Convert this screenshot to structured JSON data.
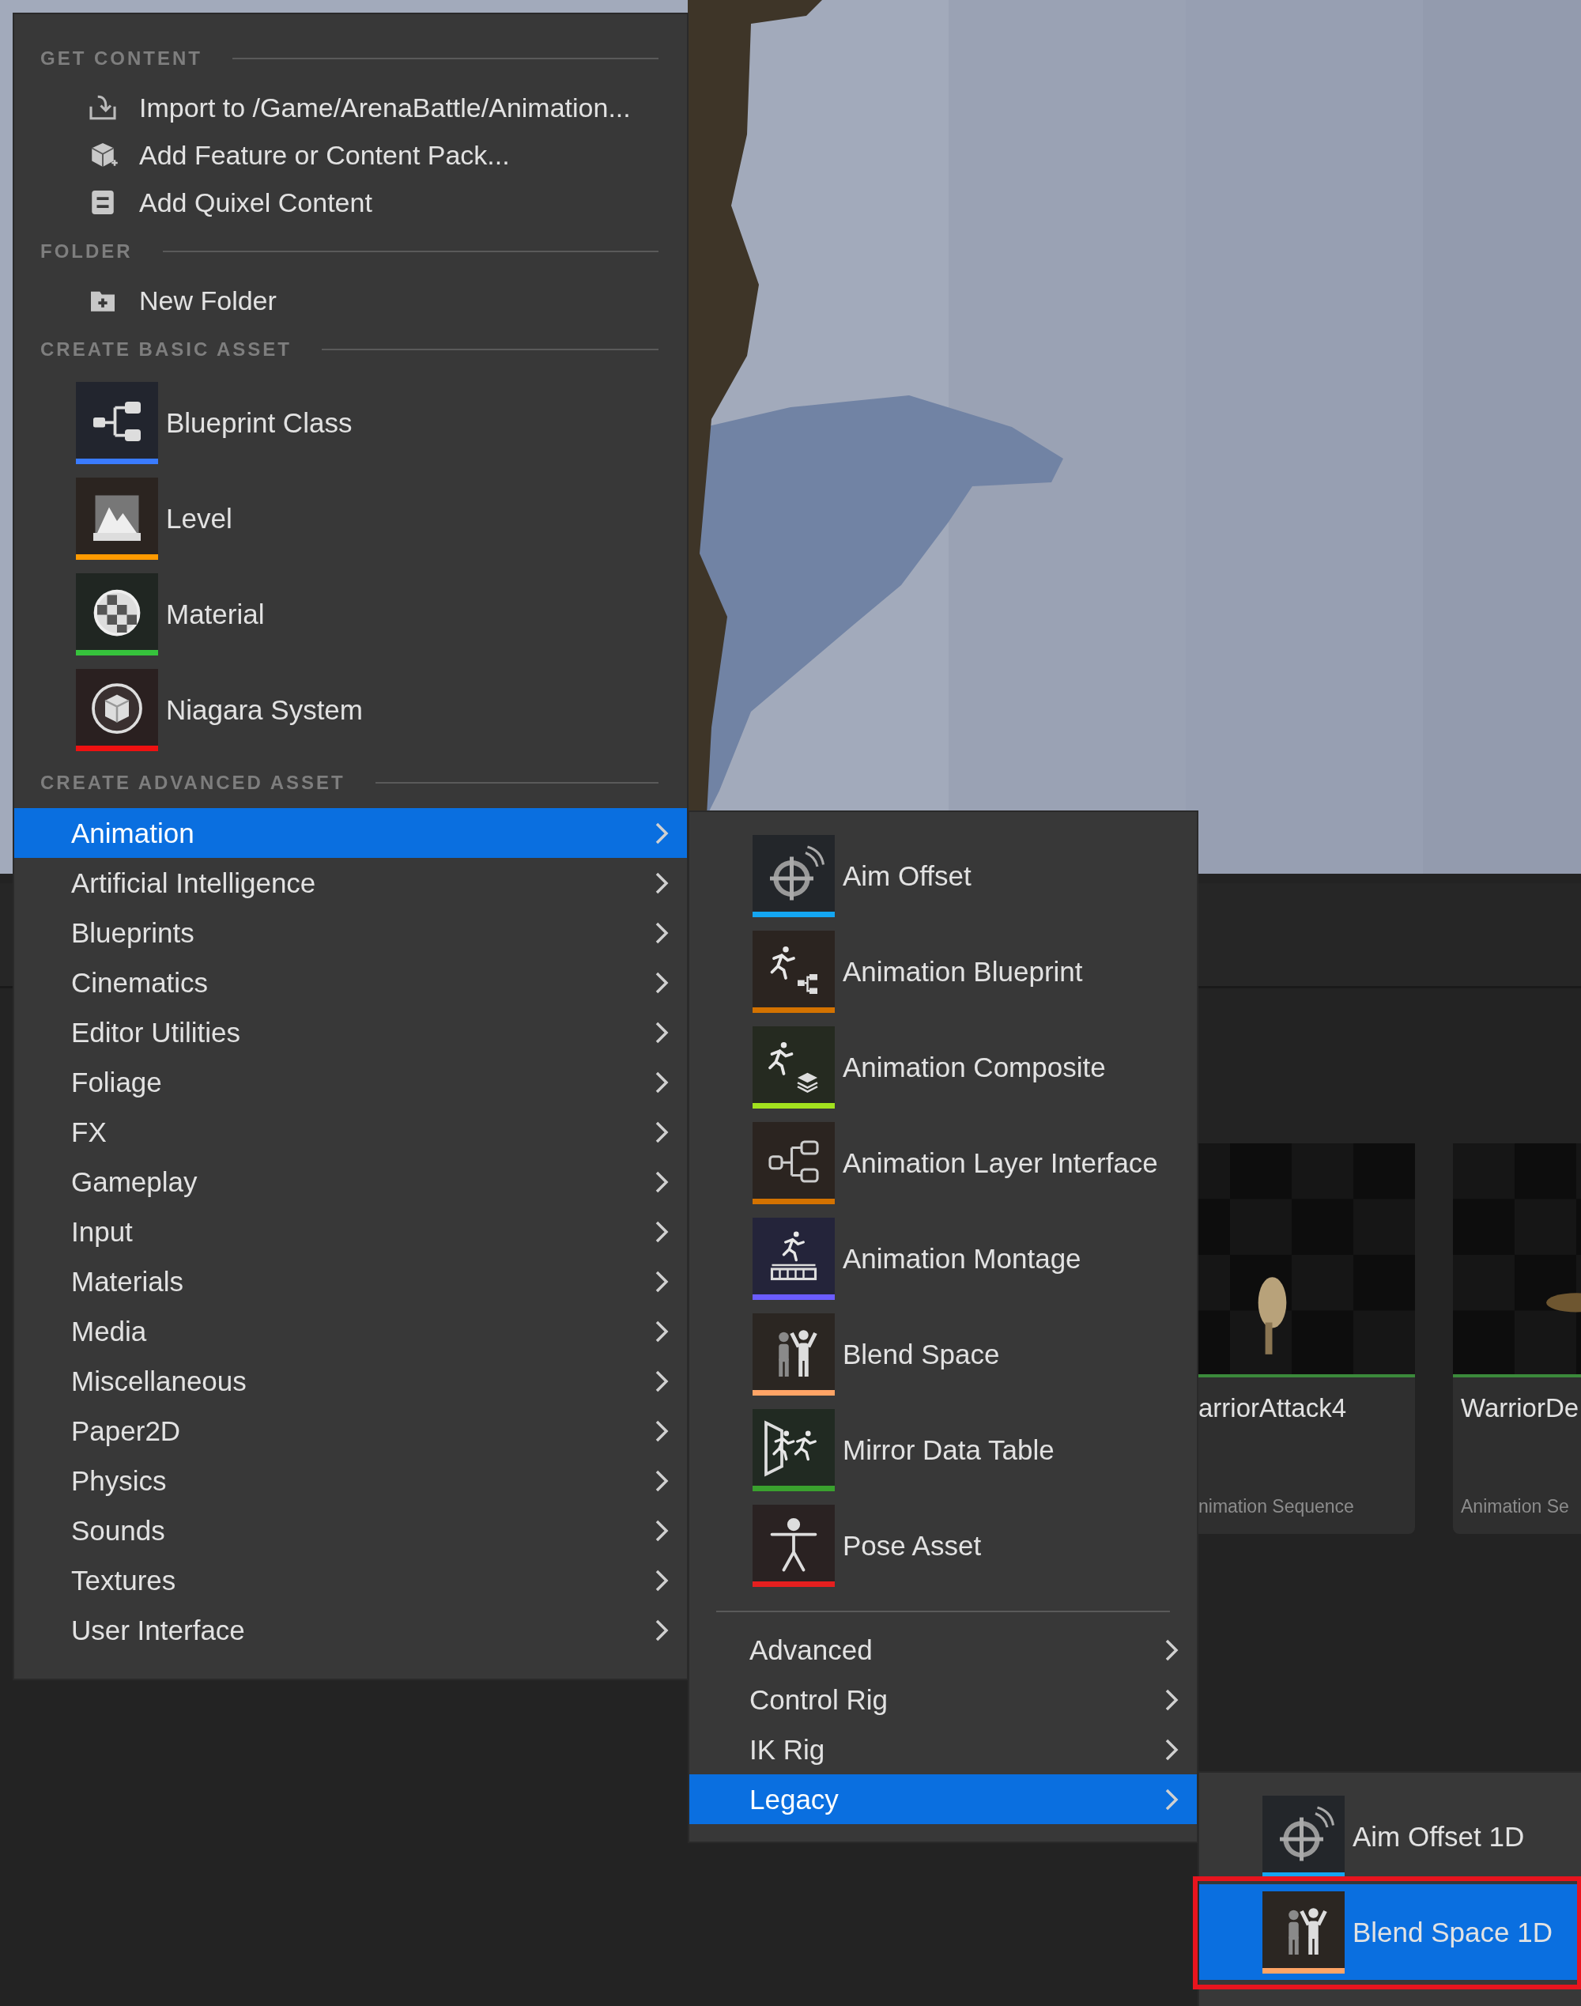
{
  "menu": {
    "sections": [
      {
        "header": "GET CONTENT",
        "items": [
          {
            "kind": "import",
            "label": "Import to /Game/ArenaBattle/Animation..."
          },
          {
            "kind": "pack",
            "label": "Add Feature or Content Pack..."
          },
          {
            "kind": "quixel",
            "label": "Add Quixel Content"
          }
        ]
      },
      {
        "header": "FOLDER",
        "items": [
          {
            "kind": "folder",
            "label": "New Folder"
          }
        ]
      },
      {
        "header": "CREATE BASIC ASSET",
        "assets": [
          {
            "kind": "blueprint",
            "label": "Blueprint Class",
            "color": "#3a7bff"
          },
          {
            "kind": "landscape",
            "label": "Level",
            "color": "#ff9a00"
          },
          {
            "kind": "sphere",
            "label": "Material",
            "color": "#36c23c"
          },
          {
            "kind": "cube",
            "label": "Niagara System",
            "color": "#ee1111"
          }
        ]
      },
      {
        "header": "CREATE ADVANCED ASSET",
        "categories": [
          {
            "label": "Animation",
            "selected": true
          },
          {
            "label": "Artificial Intelligence",
            "selected": false
          },
          {
            "label": "Blueprints",
            "selected": false
          },
          {
            "label": "Cinematics",
            "selected": false
          },
          {
            "label": "Editor Utilities",
            "selected": false
          },
          {
            "label": "Foliage",
            "selected": false
          },
          {
            "label": "FX",
            "selected": false
          },
          {
            "label": "Gameplay",
            "selected": false
          },
          {
            "label": "Input",
            "selected": false
          },
          {
            "label": "Materials",
            "selected": false
          },
          {
            "label": "Media",
            "selected": false
          },
          {
            "label": "Miscellaneous",
            "selected": false
          },
          {
            "label": "Paper2D",
            "selected": false
          },
          {
            "label": "Physics",
            "selected": false
          },
          {
            "label": "Sounds",
            "selected": false
          },
          {
            "label": "Textures",
            "selected": false
          },
          {
            "label": "User Interface",
            "selected": false
          }
        ]
      }
    ]
  },
  "animation_submenu": {
    "assets": [
      {
        "kind": "crosshair",
        "label": "Aim Offset",
        "color": "#14a6f2"
      },
      {
        "kind": "runner-graph",
        "label": "Animation Blueprint",
        "color": "#d37200"
      },
      {
        "kind": "runner-layers",
        "label": "Animation Composite",
        "color": "#a2e21e"
      },
      {
        "kind": "graph",
        "label": "Animation Layer Interface",
        "color": "#d37200"
      },
      {
        "kind": "runner-track",
        "label": "Animation Montage",
        "color": "#6b5cff"
      },
      {
        "kind": "figures",
        "label": "Blend Space",
        "color": "#ffa466"
      },
      {
        "kind": "mirror",
        "label": "Mirror Data Table",
        "color": "#3aa12e"
      },
      {
        "kind": "pose",
        "label": "Pose Asset",
        "color": "#e51f1f"
      }
    ],
    "categories": [
      {
        "label": "Advanced",
        "selected": false
      },
      {
        "label": "Control Rig",
        "selected": false
      },
      {
        "label": "IK Rig",
        "selected": false
      },
      {
        "label": "Legacy",
        "selected": true
      }
    ]
  },
  "legacy_submenu": {
    "assets": [
      {
        "kind": "crosshair",
        "label": "Aim Offset 1D",
        "color": "#14a6f2",
        "selected": false,
        "outlined": false
      },
      {
        "kind": "figures",
        "label": "Blend Space 1D",
        "color": "#ffa466",
        "selected": true,
        "outlined": true
      }
    ]
  },
  "asset_tiles": [
    {
      "name": "arriorAttack4",
      "type": "nimation Sequence"
    },
    {
      "name": "WarriorDe",
      "type": "Animation Se"
    }
  ]
}
